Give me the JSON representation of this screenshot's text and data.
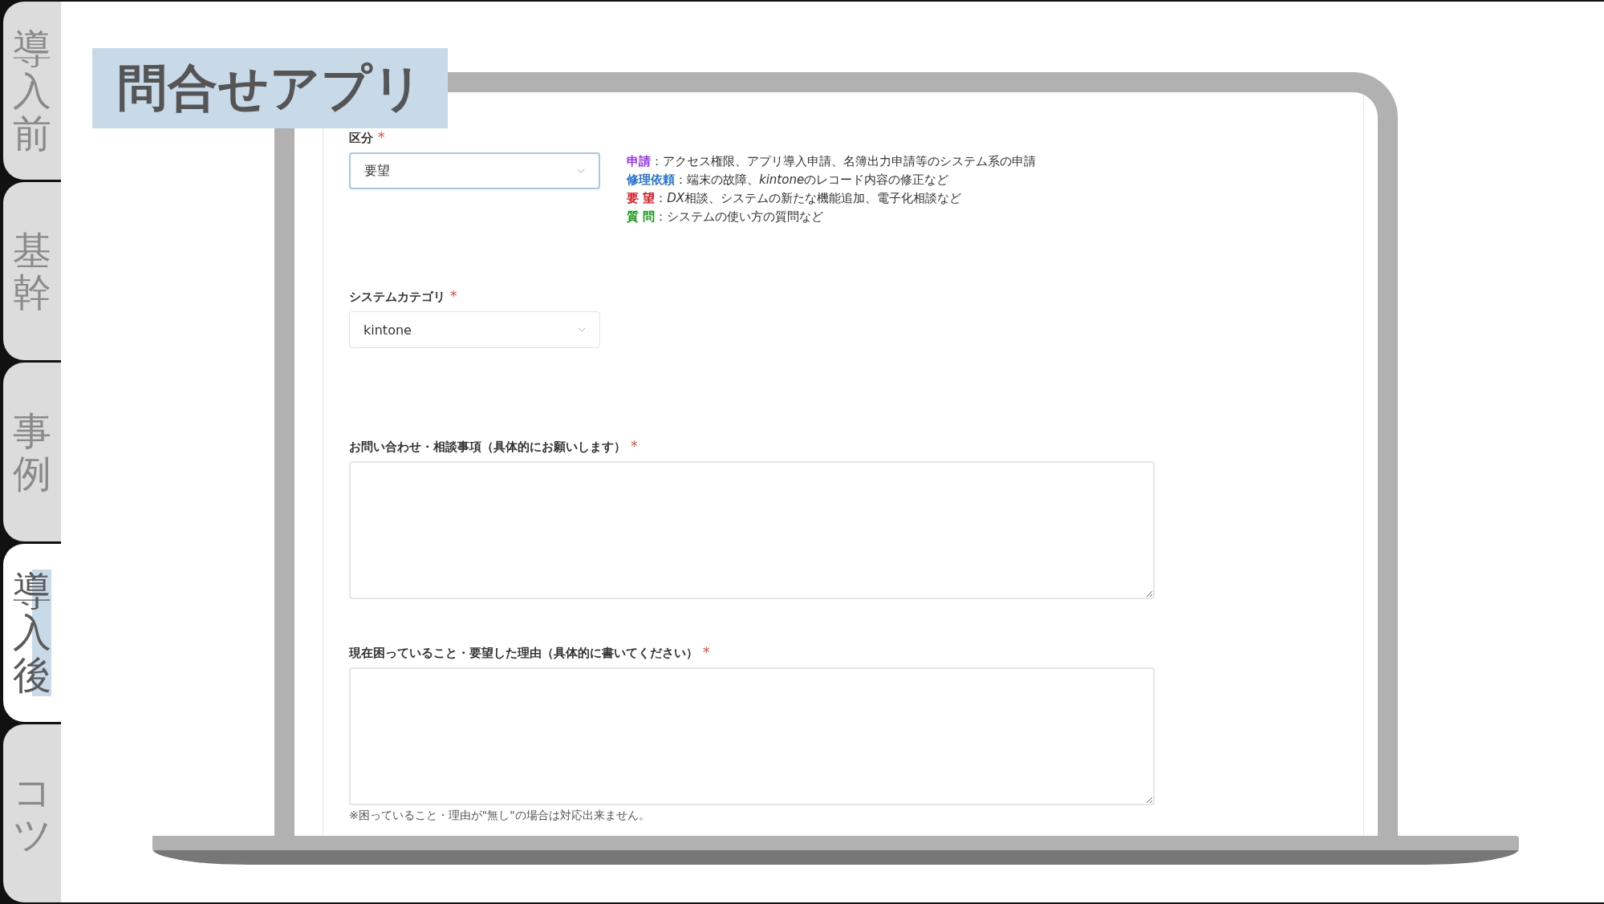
{
  "side_tabs": [
    {
      "label": "導入前",
      "selected": false
    },
    {
      "label": "基幹",
      "selected": false
    },
    {
      "label": "事例",
      "selected": false
    },
    {
      "label": "導入後",
      "selected": true
    },
    {
      "label": "コツ",
      "selected": false
    }
  ],
  "banner": {
    "title": "問合せアプリ"
  },
  "form": {
    "fields": [
      {
        "kind": "select",
        "label": "区分",
        "required_mark": "*",
        "value": "要望",
        "focused": true,
        "legend": [
          {
            "term": "申請",
            "color": "#9b30ff",
            "parts": [
              {
                "text": "：アクセス権限、アプリ導入申請、名簿出力申請等のシステム系の申請",
                "italic": false
              }
            ]
          },
          {
            "term": "修理依頼",
            "color": "#1e6fd9",
            "parts": [
              {
                "text": "：端末の故障、",
                "italic": false
              },
              {
                "text": "kintone",
                "italic": true
              },
              {
                "text": "のレコード内容の修正など",
                "italic": false
              }
            ]
          },
          {
            "term": "要 望",
            "color": "#e0141e",
            "parts": [
              {
                "text": "：",
                "italic": false
              },
              {
                "text": "DX",
                "italic": true
              },
              {
                "text": "相談、システムの新たな機能追加、電子化相談など",
                "italic": false
              }
            ]
          },
          {
            "term": "質 問",
            "color": "#1a9a1a",
            "parts": [
              {
                "text": "：システムの使い方の質問など",
                "italic": false
              }
            ]
          }
        ]
      },
      {
        "kind": "select",
        "label": "システムカテゴリ",
        "required_mark": "*",
        "value": "kintone",
        "focused": false
      },
      {
        "kind": "textarea",
        "label": "お問い合わせ・相談事項（具体的にお願いします）",
        "required_mark": "*"
      },
      {
        "kind": "textarea",
        "label": "現在困っていること・要望した理由（具体的に書いてください）",
        "required_mark": "*",
        "note": "※困っていること・理由が\"無し\"の場合は対応出来ません。"
      }
    ]
  }
}
